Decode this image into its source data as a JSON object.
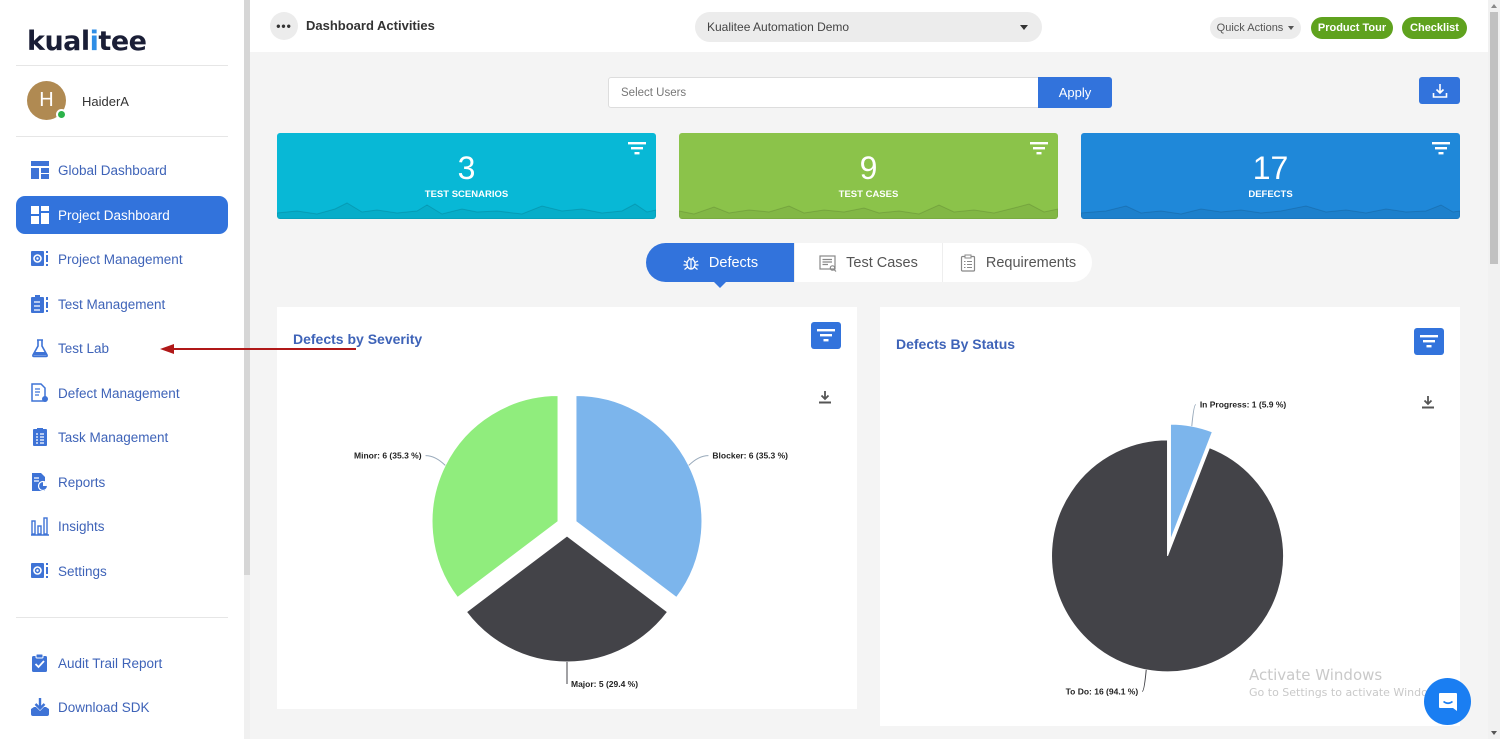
{
  "sidebar": {
    "logo": {
      "prefix": "kual",
      "i": "i",
      "suffix": "tee"
    },
    "user": {
      "initial": "H",
      "name": "HaiderA",
      "status": "online"
    },
    "items": [
      {
        "label": "Global Dashboard",
        "icon": "dashboard-grid-icon",
        "active": false
      },
      {
        "label": "Project Dashboard",
        "icon": "dashboard-tiles-icon",
        "active": true
      },
      {
        "label": "Project Management",
        "icon": "project-gear-icon",
        "active": false
      },
      {
        "label": "Test Management",
        "icon": "test-clipboard-icon",
        "active": false
      },
      {
        "label": "Test Lab",
        "icon": "flask-icon",
        "active": false
      },
      {
        "label": "Defect Management",
        "icon": "defect-document-icon",
        "active": false
      },
      {
        "label": "Task Management",
        "icon": "task-list-icon",
        "active": false
      },
      {
        "label": "Reports",
        "icon": "report-icon",
        "active": false
      },
      {
        "label": "Insights",
        "icon": "bar-chart-icon",
        "active": false
      },
      {
        "label": "Settings",
        "icon": "settings-gear-icon",
        "active": false
      }
    ],
    "bottom_items": [
      {
        "label": "Audit Trail Report",
        "icon": "clipboard-check-icon"
      },
      {
        "label": "Download SDK",
        "icon": "download-tray-icon"
      }
    ]
  },
  "topbar": {
    "menu_icon": "more-dots-icon",
    "title": "Dashboard Activities",
    "project_select": "Kualitee Automation Demo",
    "quick_actions": "Quick Actions",
    "product_tour": "Product Tour",
    "checklist": "Checklist"
  },
  "filters": {
    "users_placeholder": "Select Users",
    "apply": "Apply"
  },
  "stats": [
    {
      "value": "3",
      "label": "TEST SCENARIOS",
      "color": "#08b8d6"
    },
    {
      "value": "9",
      "label": "TEST CASES",
      "color": "#8bc34a"
    },
    {
      "value": "17",
      "label": "DEFECTS",
      "color": "#1f88d9"
    }
  ],
  "tabs": [
    {
      "label": "Defects",
      "icon": "bug-icon",
      "active": true
    },
    {
      "label": "Test Cases",
      "icon": "test-cases-icon",
      "active": false
    },
    {
      "label": "Requirements",
      "icon": "requirements-clipboard-icon",
      "active": false
    }
  ],
  "colors": {
    "primary": "#3273dc",
    "green": "#5fa21e",
    "blue_slice": "#7cb5ec",
    "dark_slice": "#434348",
    "green_slice": "#90ed7d"
  },
  "watermark": {
    "line1": "Activate Windows",
    "line2": "Go to Settings to activate Windows."
  },
  "chart_data": [
    {
      "type": "pie",
      "title": "Defects by Severity",
      "categories": [
        "Blocker",
        "Major",
        "Minor"
      ],
      "values": [
        6,
        5,
        6
      ],
      "percentages": [
        35.3,
        29.4,
        35.3
      ],
      "colors": [
        "#7cb5ec",
        "#434348",
        "#90ed7d"
      ],
      "labels": [
        "Blocker: 6 (35.3 %)",
        "Major: 5 (29.4 %)",
        "Minor: 6 (35.3 %)"
      ]
    },
    {
      "type": "pie",
      "title": "Defects By Status",
      "categories": [
        "In Progress",
        "To Do"
      ],
      "values": [
        1,
        16
      ],
      "percentages": [
        5.9,
        94.1
      ],
      "colors": [
        "#7cb5ec",
        "#434348"
      ],
      "labels": [
        "In Progress: 1 (5.9 %)",
        "To Do: 16 (94.1 %)"
      ]
    }
  ]
}
